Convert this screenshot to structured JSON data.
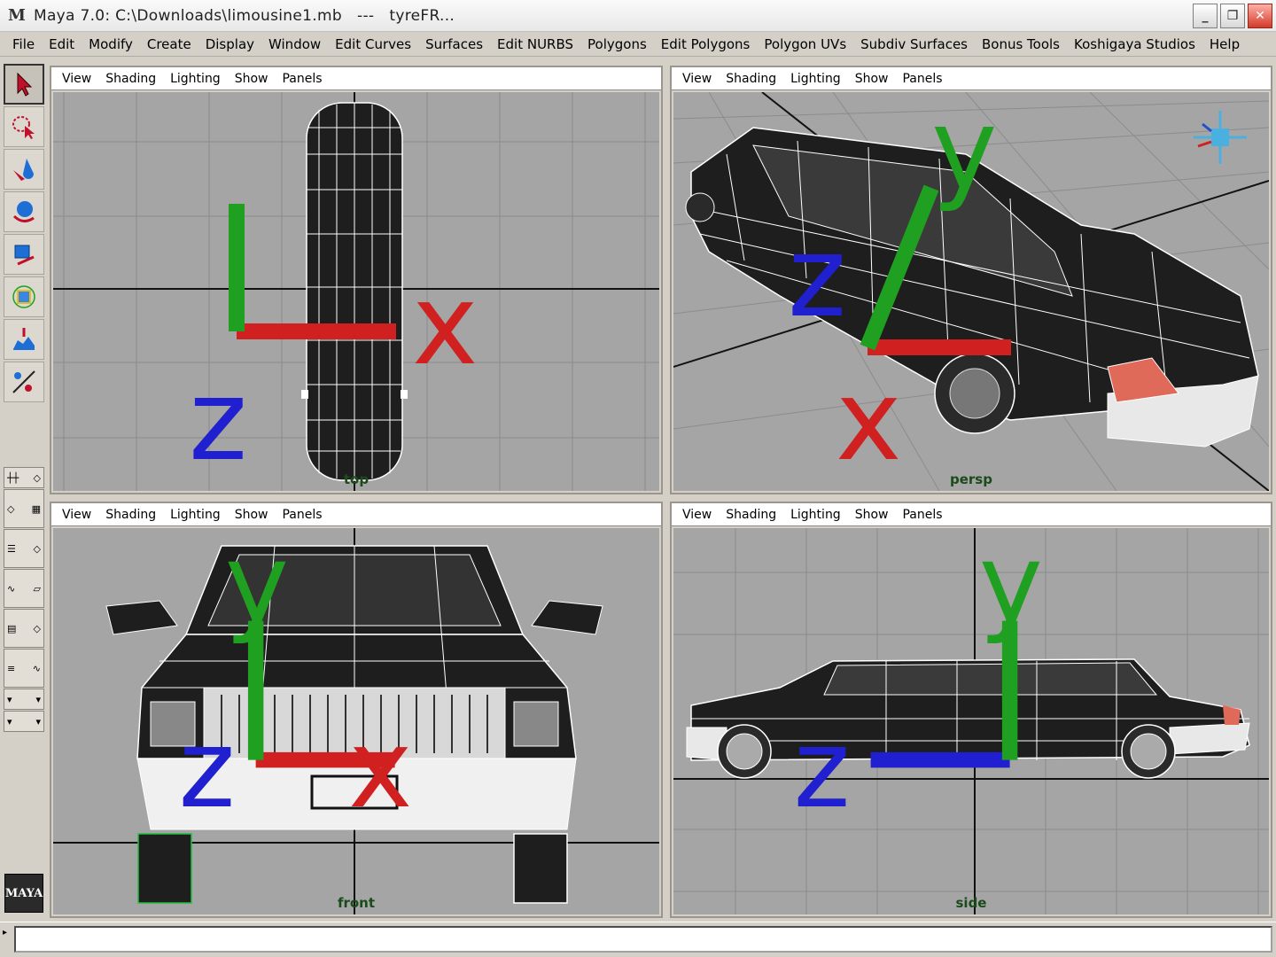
{
  "window": {
    "title": "Maya 7.0: C:\\Downloads\\limousine1.mb   ---   tyreFR...",
    "logo": "M",
    "controls": {
      "minimize": "_",
      "maximize": "❐",
      "close": "✕"
    }
  },
  "menubar": {
    "items": [
      "File",
      "Edit",
      "Modify",
      "Create",
      "Display",
      "Window",
      "Edit Curves",
      "Surfaces",
      "Edit NURBS",
      "Polygons",
      "Edit Polygons",
      "Polygon UVs",
      "Subdiv Surfaces",
      "Bonus Tools",
      "Koshigaya Studios",
      "Help"
    ]
  },
  "toolbox": {
    "tools": [
      "select-tool-icon",
      "lasso-tool-icon",
      "paint-select-icon",
      "move-tool-icon",
      "rotate-tool-icon",
      "scale-tool-icon",
      "manipulator-icon",
      "sculpt-tool-icon"
    ],
    "logo_text": "MAYA"
  },
  "panel_menu": {
    "view": "View",
    "shading": "Shading",
    "lighting": "Lighting",
    "show": "Show",
    "panels": "Panels"
  },
  "panels": {
    "top": {
      "camera": "top",
      "axis_h": "x",
      "axis_v": "z"
    },
    "persp": {
      "camera": "persp",
      "axis_h": "x",
      "axis_v": "y",
      "axis_z": "z"
    },
    "front": {
      "camera": "front",
      "axis_h": "x",
      "axis_v": "y",
      "axis_z": "z"
    },
    "side": {
      "camera": "side",
      "axis_h": "z",
      "axis_v": "y"
    }
  },
  "colors": {
    "viewport_bg": "#a5a5a5",
    "grid_line": "#8c8c8c",
    "axis_line": "#111111",
    "wireframe": "#ffffff",
    "body": "#1e1e1e",
    "taillight": "#e06a5a",
    "camera_label": "#1b4a1b"
  }
}
